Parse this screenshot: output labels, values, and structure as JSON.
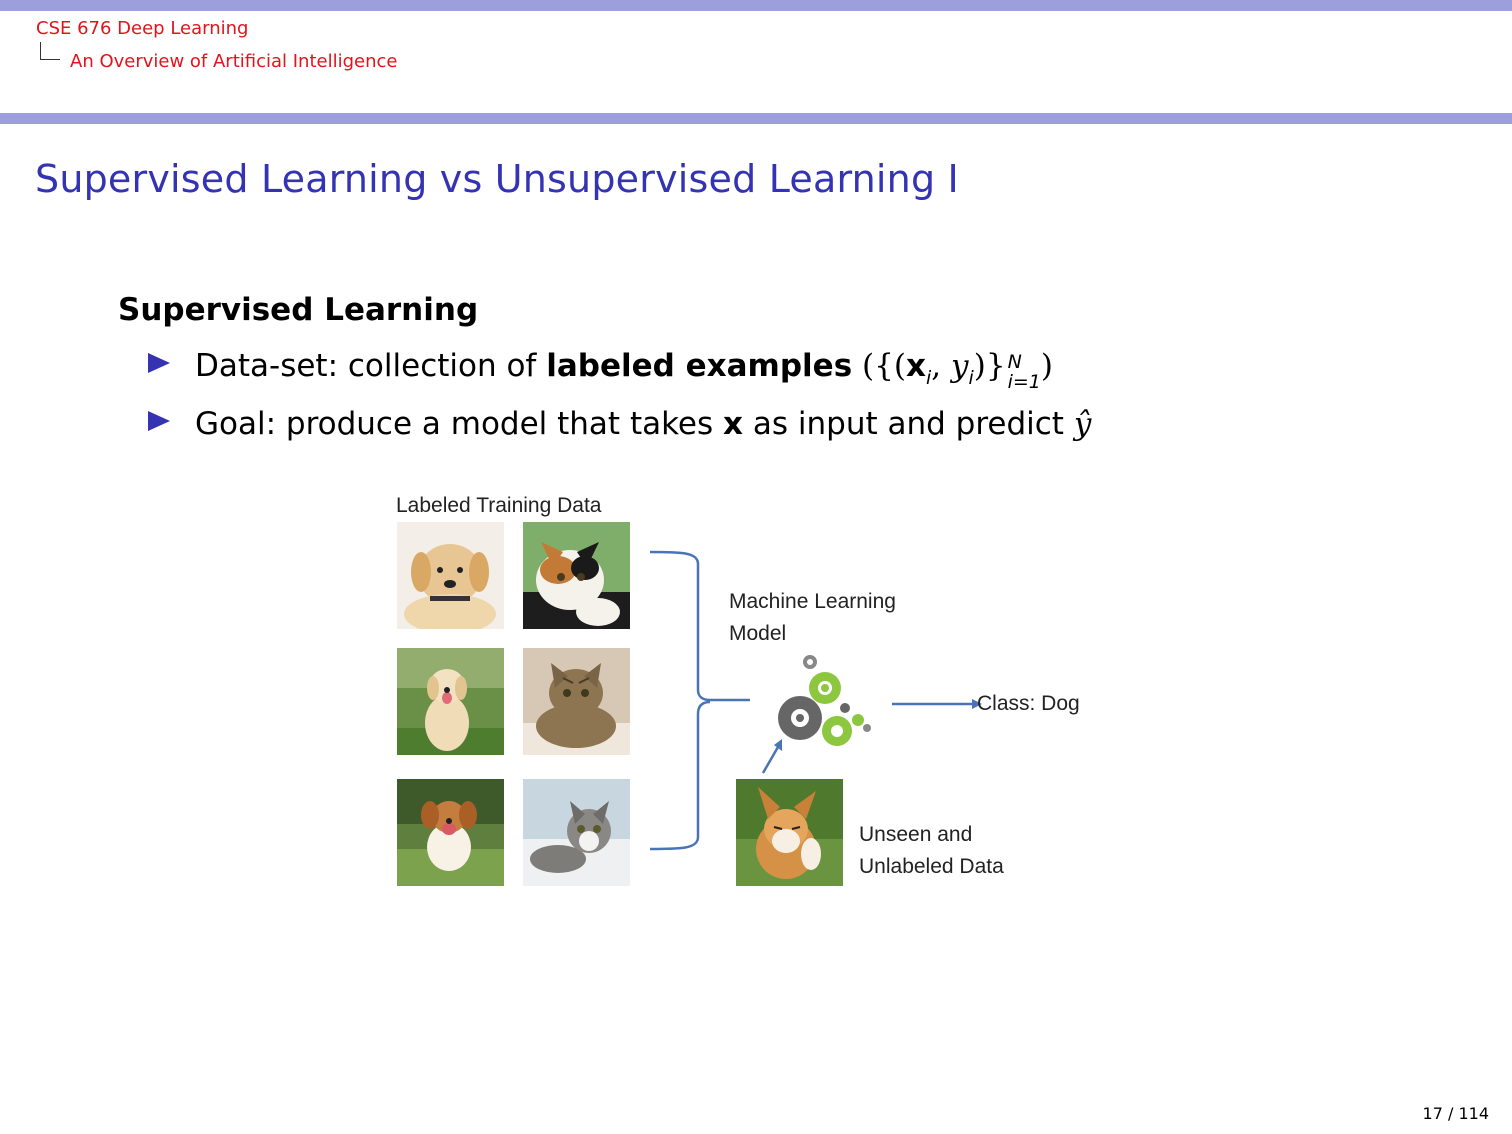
{
  "header": {
    "course": "CSE 676 Deep Learning",
    "section": "An Overview of Artificial Intelligence"
  },
  "slide": {
    "title": "Supervised Learning vs Unsupervised Learning I",
    "section_heading": "Supervised Learning",
    "bullets": [
      {
        "prefix": "Data-set: collection of",
        "bold": "labeled examples",
        "math_open": "({(",
        "x": "x",
        "i1": "i",
        "comma": ",",
        "y": "y",
        "i2": "i",
        "close": ")}",
        "sup": "N",
        "sub": "i=1",
        "math_close": ")"
      },
      {
        "prefix": "Goal: produce a model that takes",
        "bold": "x",
        "suffix": "as input and predict",
        "yhat": "ŷ"
      }
    ]
  },
  "figure": {
    "labeled_title": "Labeled Training Data",
    "model_line1": "Machine Learning",
    "model_line2": "Model",
    "class_label": "Class: Dog",
    "unseen_line1": "Unseen and",
    "unseen_line2": "Unlabeled Data",
    "photos": [
      "puppy",
      "calico cat",
      "dog sitting",
      "tabby cat",
      "running dog",
      "kitten",
      "corgi"
    ],
    "arrow_color": "#4a74b7",
    "gear_green": "#8dc63f",
    "gear_gray": "#666666"
  },
  "footer": {
    "page": "17 / 114"
  }
}
